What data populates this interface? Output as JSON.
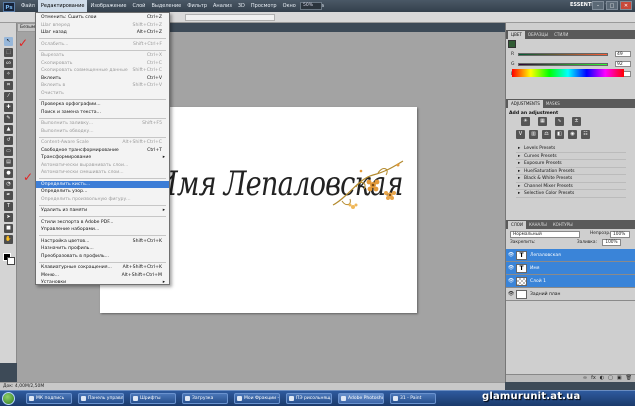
{
  "menubar": {
    "logo": "Ps",
    "items": [
      "Файл",
      "Редактирование",
      "Изображение",
      "Слой",
      "Выделение",
      "Фильтр",
      "Анализ",
      "3D",
      "Просмотр",
      "Окно",
      "Справка"
    ],
    "active_index": 1,
    "zoom": "50%",
    "workspace": "ESSENTIALS ▾",
    "window_buttons": [
      "–",
      "□",
      "✕"
    ]
  },
  "document_tab": "Безымянный-1 @ 50%",
  "status": "Док: 4,00М/2,50М",
  "edit_menu": {
    "items": [
      {
        "label": "Отменить: Сшить слои",
        "sc": "Ctrl+Z",
        "dis": false
      },
      {
        "label": "Шаг вперед",
        "sc": "Shift+Ctrl+Z",
        "dis": true
      },
      {
        "label": "Шаг назад",
        "sc": "Alt+Ctrl+Z",
        "dis": false
      },
      {
        "sep": true
      },
      {
        "label": "Ослабить...",
        "sc": "Shift+Ctrl+F",
        "dis": true
      },
      {
        "sep": true
      },
      {
        "label": "Вырезать",
        "sc": "Ctrl+X",
        "dis": true
      },
      {
        "label": "Скопировать",
        "sc": "Ctrl+C",
        "dis": true
      },
      {
        "label": "Скопировать совмещенные данные",
        "sc": "Shift+Ctrl+C",
        "dis": true
      },
      {
        "label": "Вклеить",
        "sc": "Ctrl+V",
        "dis": false
      },
      {
        "label": "Вклеить в",
        "sc": "Shift+Ctrl+V",
        "dis": true
      },
      {
        "label": "Очистить",
        "sc": "",
        "dis": true
      },
      {
        "sep": true
      },
      {
        "label": "Проверка орфографии...",
        "sc": "",
        "dis": false
      },
      {
        "label": "Поиск и замена текста...",
        "sc": "",
        "dis": false
      },
      {
        "sep": true
      },
      {
        "label": "Выполнить заливку...",
        "sc": "Shift+F5",
        "dis": true
      },
      {
        "label": "Выполнить обводку...",
        "sc": "",
        "dis": true
      },
      {
        "sep": true
      },
      {
        "label": "Content-Aware Scale",
        "sc": "Alt+Shift+Ctrl+C",
        "dis": true
      },
      {
        "label": "Свободное трансформирование",
        "sc": "Ctrl+T",
        "dis": false
      },
      {
        "label": "Трансформирование",
        "sc": "",
        "dis": false,
        "arrow": true
      },
      {
        "label": "Автоматически выравнивать слои...",
        "sc": "",
        "dis": true
      },
      {
        "label": "Автоматически смешивать слои...",
        "sc": "",
        "dis": true
      },
      {
        "sep": true
      },
      {
        "label": "Определить кисть...",
        "sc": "",
        "dis": false,
        "hl": true
      },
      {
        "label": "Определить узор...",
        "sc": "",
        "dis": false
      },
      {
        "label": "Определить произвольную фигуру...",
        "sc": "",
        "dis": true
      },
      {
        "sep": true
      },
      {
        "label": "Удалить из памяти",
        "sc": "",
        "dis": false,
        "arrow": true
      },
      {
        "sep": true
      },
      {
        "label": "Стили экспорта в Adobe PDF...",
        "sc": "",
        "dis": false
      },
      {
        "label": "Управление наборами...",
        "sc": "",
        "dis": false
      },
      {
        "sep": true
      },
      {
        "label": "Настройка цветов...",
        "sc": "Shift+Ctrl+K",
        "dis": false
      },
      {
        "label": "Назначить профиль...",
        "sc": "",
        "dis": false
      },
      {
        "label": "Преобразовать в профиль...",
        "sc": "",
        "dis": false
      },
      {
        "sep": true
      },
      {
        "label": "Клавиатурные сокращения...",
        "sc": "Alt+Shift+Ctrl+K",
        "dis": false
      },
      {
        "label": "Меню...",
        "sc": "Alt+Shift+Ctrl+M",
        "dis": false
      },
      {
        "label": "Установки",
        "sc": "",
        "dis": false,
        "arrow": true
      }
    ]
  },
  "canvas_text": "Имя Лепаловская",
  "color_panel": {
    "tabs": [
      "ЦВЕТ",
      "ОБРАЗЦЫ",
      "СТИЛИ"
    ],
    "rows": [
      {
        "label": "R",
        "value": "49"
      },
      {
        "label": "G",
        "value": "92"
      },
      {
        "label": "B",
        "value": "52"
      }
    ]
  },
  "adjustments": {
    "tabs": [
      "ADJUSTMENTS",
      "MASKS"
    ],
    "title": "Add an adjustment",
    "presets": [
      "Levels Presets",
      "Curves Presets",
      "Exposure Presets",
      "Hue/Saturation Presets",
      "Black & White Presets",
      "Channel Mixer Presets",
      "Selective Color Presets"
    ]
  },
  "layers": {
    "tabs": [
      "СЛОИ",
      "КАНАЛЫ",
      "КОНТУРЫ"
    ],
    "blend_mode": "Нормальный",
    "opacity_label": "Непрозр.:",
    "opacity": "100%",
    "lock_label": "Закрепить:",
    "fill_label": "Заливка:",
    "fill": "100%",
    "items": [
      {
        "name": "Лепаловская",
        "thumb": "T",
        "sel": true
      },
      {
        "name": "Имя",
        "thumb": "T",
        "sel": true
      },
      {
        "name": "Слой 1",
        "thumb": "",
        "sel": true
      },
      {
        "name": "Задний план",
        "thumb": "",
        "sel": false
      }
    ],
    "bottom_icons": [
      "∞",
      "fx",
      "◐",
      "▢",
      "▣",
      "🗑"
    ]
  },
  "taskbar": {
    "buttons": [
      "МК подпись",
      "Панель управлен...",
      "Шрифты",
      "Загрузка",
      "Мои Фракции - б...",
      "ПЭ рисольнящ...",
      "Adobe Photoshop...",
      "31 - Paint"
    ],
    "active_index": 6
  },
  "watermark": "glamurunit.at.ua",
  "icons": [
    "photoshop-logo",
    "move-tool-icon",
    "marquee-tool-icon",
    "lasso-tool-icon",
    "brush-tool-icon",
    "type-tool-icon",
    "eye-icon",
    "trash-icon",
    "windows-start-icon"
  ],
  "colors": {
    "highlight": "#3c7dd6",
    "checkmark": "#e02424",
    "taskbar": "#1b3a6b"
  }
}
